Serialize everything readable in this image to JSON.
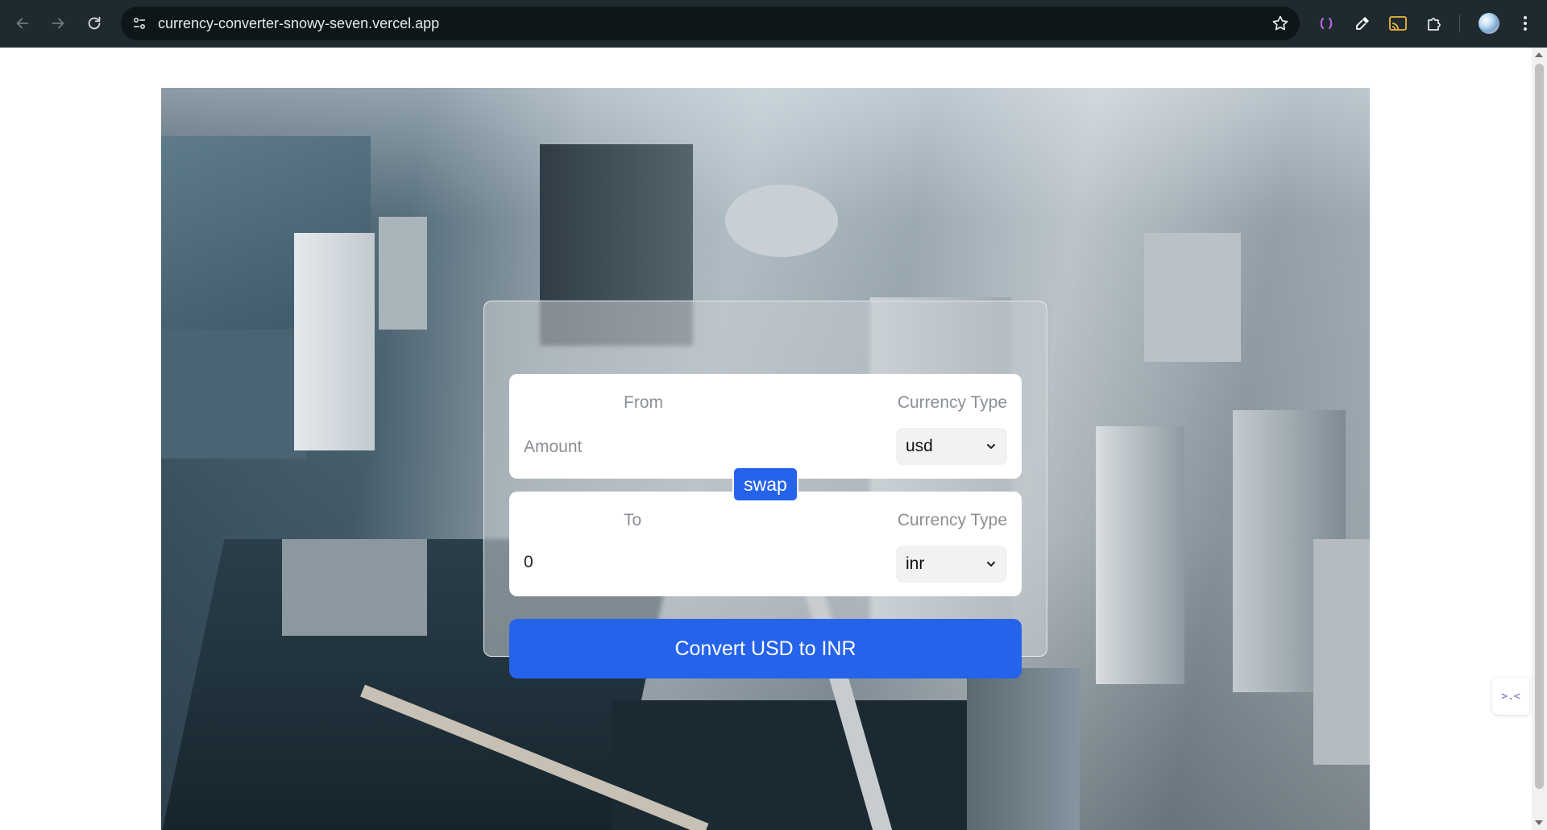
{
  "browser": {
    "url": "currency-converter-snowy-seven.vercel.app"
  },
  "converter": {
    "from": {
      "label": "From",
      "currency_label": "Currency Type",
      "amount_placeholder": "Amount",
      "currency": "usd"
    },
    "swap_label": "swap",
    "to": {
      "label": "To",
      "currency_label": "Currency Type",
      "amount": "0",
      "currency": "inr"
    },
    "convert_label": "Convert USD to INR"
  },
  "colors": {
    "primary": "#2563eb",
    "chrome_bg": "#1f2a30",
    "omnibox_bg": "#0e1619"
  },
  "icons": {
    "back": "back-arrow-icon",
    "forward": "forward-arrow-icon",
    "reload": "reload-icon",
    "site_info": "site-info-icon",
    "bookmark": "star-icon",
    "extensions": [
      "bracket-extension-icon",
      "eyedropper-icon",
      "cast-icon",
      "puzzle-icon"
    ],
    "menu": "kebab-menu-icon"
  }
}
